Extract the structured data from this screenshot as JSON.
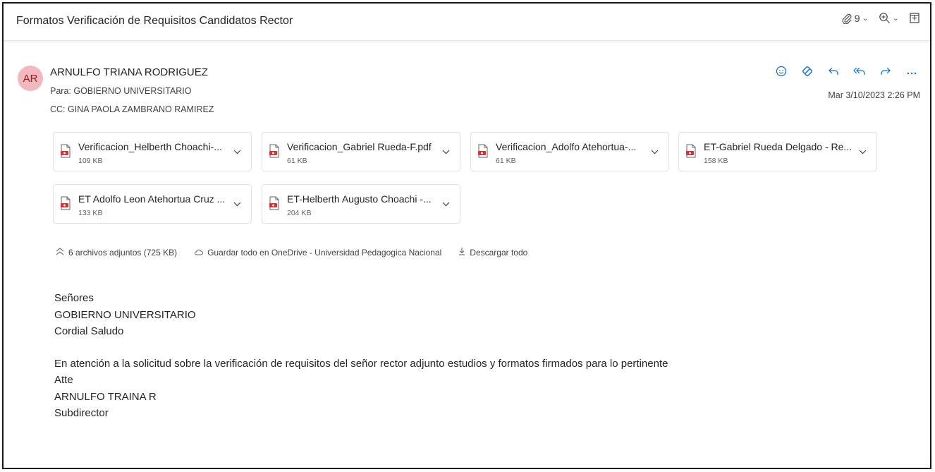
{
  "subject": "Formatos Verificación de Requisitos Candidatos Rector",
  "subject_tools": {
    "attachment_count": "9"
  },
  "sender": {
    "initials": "AR",
    "name": "ARNULFO TRIANA RODRIGUEZ",
    "to": "Para: GOBIERNO UNIVERSITARIO",
    "cc": "CC: GINA PAOLA ZAMBRANO RAMIREZ",
    "datetime": "Mar 3/10/2023 2:26 PM"
  },
  "attachments": [
    {
      "name": "Verificacion_Helberth Choachi-...",
      "size": "109 KB"
    },
    {
      "name": "Verificacion_Gabriel Rueda-F.pdf",
      "size": "61 KB"
    },
    {
      "name": "Verificacion_Adolfo Atehortua-...",
      "size": "61 KB"
    },
    {
      "name": "ET-Gabriel Rueda Delgado - Re...",
      "size": "158 KB"
    },
    {
      "name": "ET Adolfo Leon Atehortua Cruz ...",
      "size": "133 KB"
    },
    {
      "name": "ET-Helberth Augusto Choachi -...",
      "size": "204 KB"
    }
  ],
  "attachment_summary": {
    "count_label": "6 archivos adjuntos (725 KB)",
    "save_all_label": "Guardar todo en OneDrive - Universidad Pedagogica Nacional",
    "download_all_label": "Descargar todo"
  },
  "body": {
    "line1": "Señores",
    "line2": "GOBIERNO UNIVERSITARIO",
    "line3": "Cordial Saludo",
    "line4": "En atención a la solicitud sobre la verificación de requisitos del señor rector adjunto estudios y formatos firmados para lo pertinente",
    "line5": "Atte",
    "line6": "ARNULFO TRAINA R",
    "line7": "Subdirector"
  },
  "colors": {
    "accent": "#0f6cbd",
    "avatar_bg": "#f1b8bd",
    "pdf_red": "#d13438"
  }
}
